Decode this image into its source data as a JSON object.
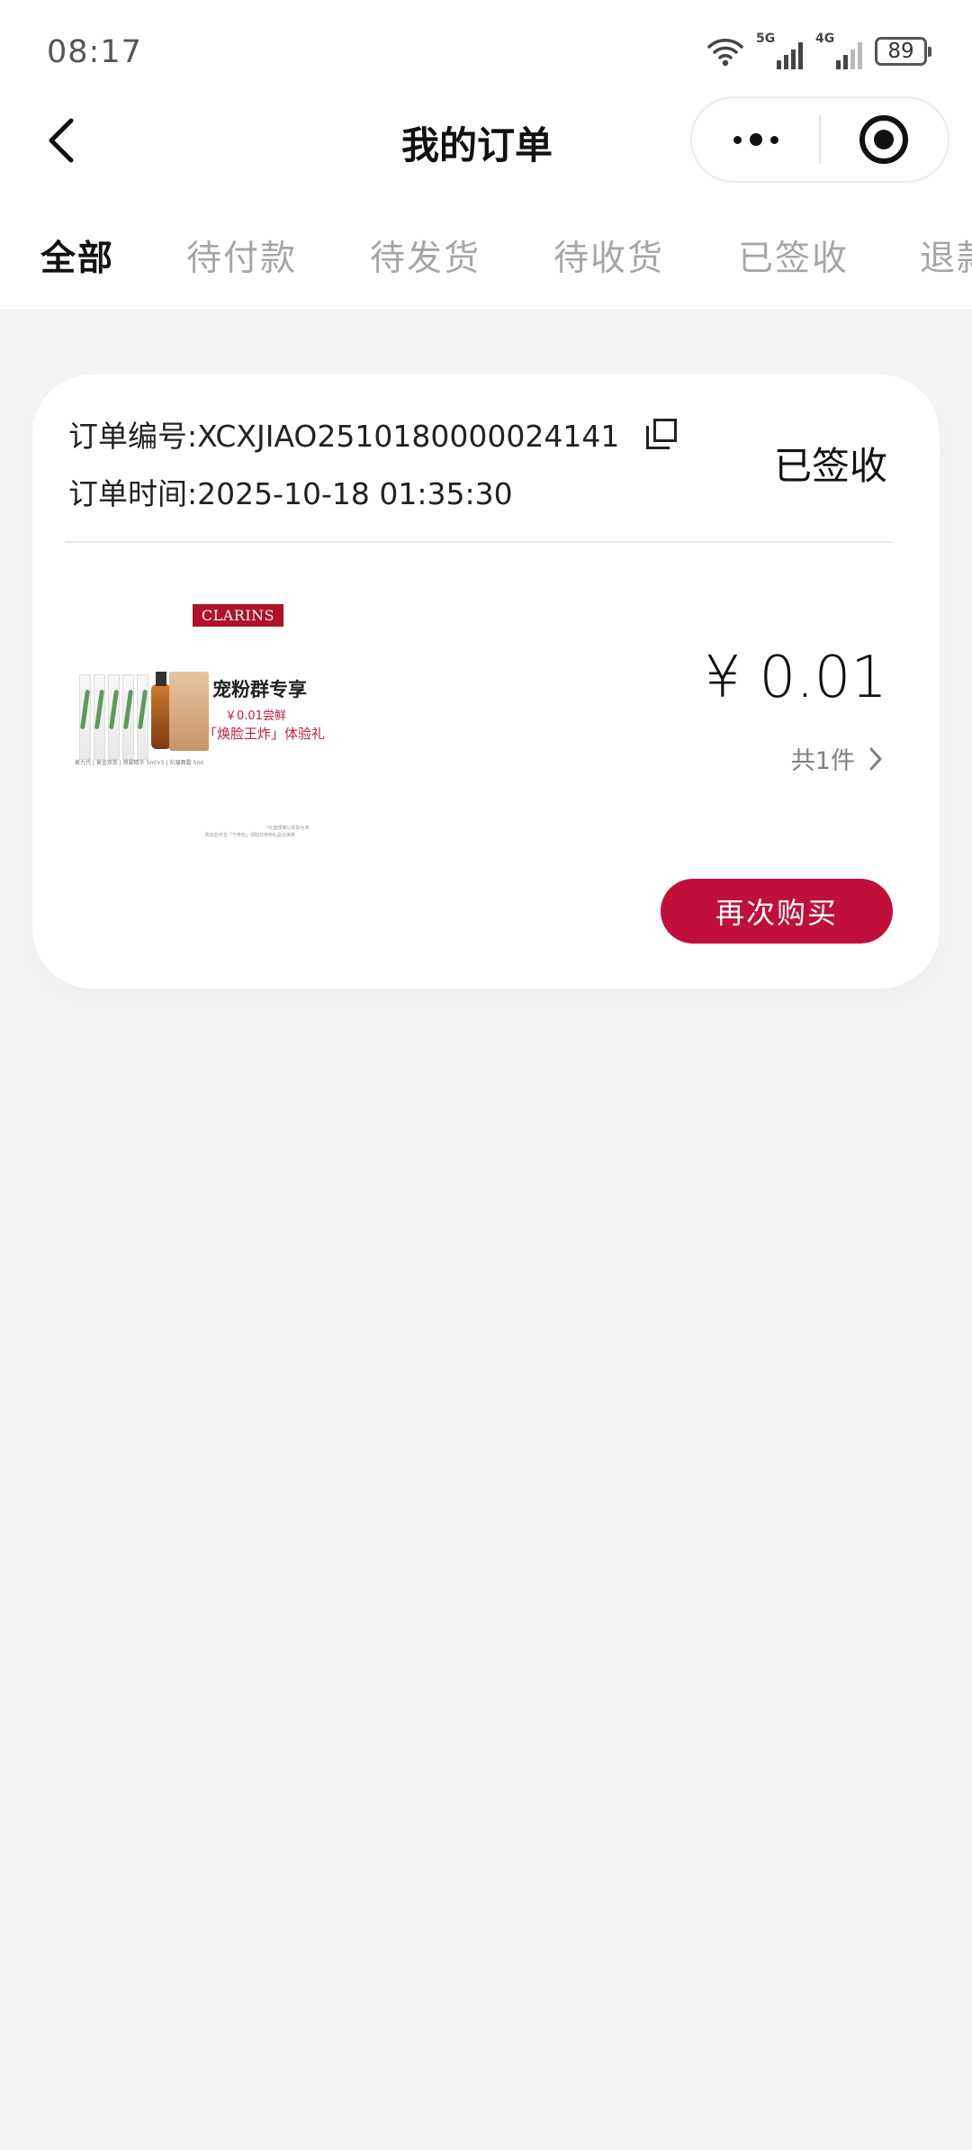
{
  "status_bar": {
    "time": "08:17",
    "net_1": "5G",
    "net_2": "4G",
    "battery": "89",
    "icons": [
      "wifi-icon",
      "signal-icon",
      "signal-icon",
      "battery-icon"
    ]
  },
  "nav": {
    "title": "我的订单",
    "icons": [
      "back-chevron-icon",
      "more-dots-icon",
      "target-circle-icon"
    ]
  },
  "tabs": [
    {
      "label": "全部",
      "active": true
    },
    {
      "label": "待付款",
      "active": false
    },
    {
      "label": "待发货",
      "active": false
    },
    {
      "label": "待收货",
      "active": false
    },
    {
      "label": "已签收",
      "active": false
    },
    {
      "label": "退款",
      "active": false
    }
  ],
  "order": {
    "number": "订单编号:XCXJIAO2510180000024141",
    "time": "订单时间:2025-10-18 01:35:30",
    "status": "已签收",
    "price": "¥ 0.01",
    "quantity": "共1件",
    "rebuy_label": "再次购买",
    "image": {
      "brand": "CLARINS",
      "headline": "宠粉群专享",
      "line1": "￥0.01尝鲜",
      "line2": "「焕脸王炸」体验礼",
      "small": "黄九代 | 黄金双萃 | 喷雾精华 5ml×5 | 抗皱面霜 5ml",
      "fine1": "*礼盒规格以实际为准",
      "fine2": "购买后可在「卡券包」领取并使用礼品兑换券"
    }
  },
  "colors": {
    "accent": "#c0103a",
    "brand_red": "#b0122a",
    "background": "#f4f4f4",
    "tab_inactive": "#a6a6a6"
  }
}
